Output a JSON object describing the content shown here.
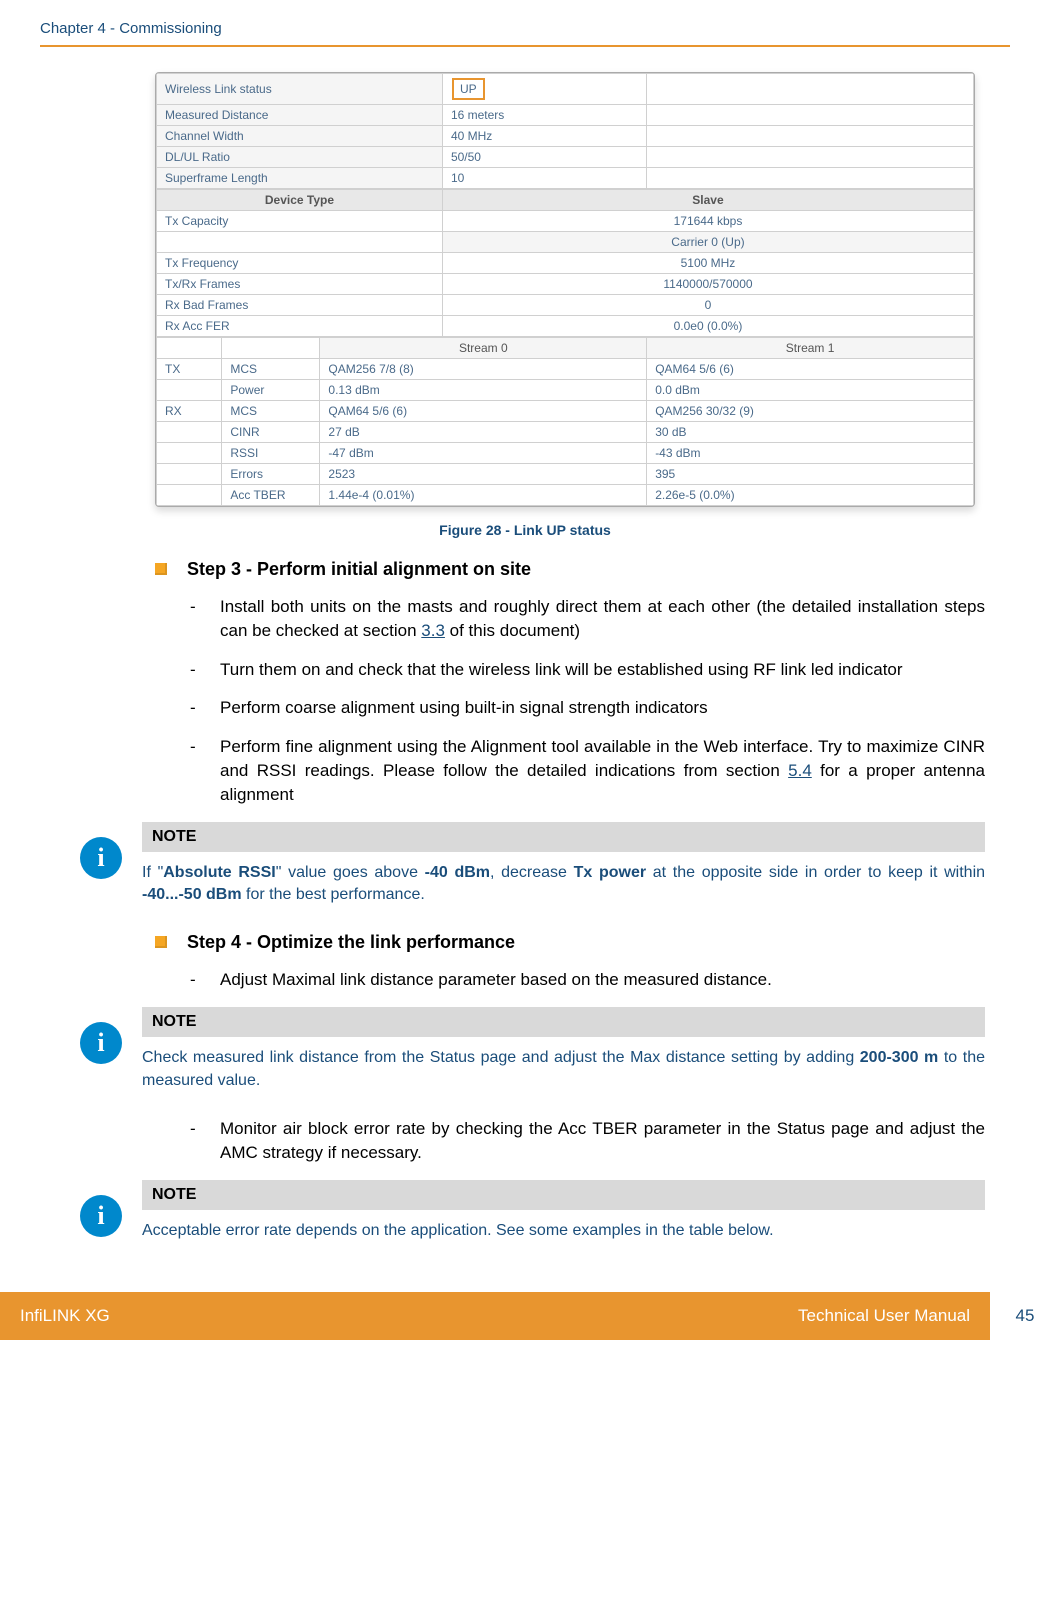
{
  "header": {
    "chapter": "Chapter 4 - Commissioning"
  },
  "screenshot": {
    "rows1": [
      {
        "label": "Wireless Link status",
        "value": "UP",
        "highlight": true
      },
      {
        "label": "Measured Distance",
        "value": "16 meters"
      },
      {
        "label": "Channel Width",
        "value": "40 MHz"
      },
      {
        "label": "DL/UL Ratio",
        "value": "50/50"
      },
      {
        "label": "Superframe Length",
        "value": "10"
      }
    ],
    "device_type_hdr": "Device Type",
    "slave_hdr": "Slave",
    "rows2": [
      {
        "label": "Tx Capacity",
        "value": "171644 kbps"
      },
      {
        "label": "",
        "value": "Carrier 0 (Up)"
      },
      {
        "label": "Tx Frequency",
        "value": "5100 MHz"
      },
      {
        "label": "Tx/Rx Frames",
        "value": "1140000/570000"
      },
      {
        "label": "Rx Bad Frames",
        "value": "0"
      },
      {
        "label": "Rx Acc FER",
        "value": "0.0e0 (0.0%)"
      }
    ],
    "stream0": "Stream 0",
    "stream1": "Stream 1",
    "stream_rows": [
      {
        "group": "TX",
        "label": "MCS",
        "s0": "QAM256 7/8 (8)",
        "s1": "QAM64 5/6 (6)"
      },
      {
        "group": "",
        "label": "Power",
        "s0": "0.13 dBm",
        "s1": "0.0 dBm"
      },
      {
        "group": "RX",
        "label": "MCS",
        "s0": "QAM64 5/6 (6)",
        "s1": "QAM256 30/32 (9)"
      },
      {
        "group": "",
        "label": "CINR",
        "s0": "27 dB",
        "s1": "30 dB"
      },
      {
        "group": "",
        "label": "RSSI",
        "s0": "-47 dBm",
        "s1": "-43 dBm"
      },
      {
        "group": "",
        "label": "Errors",
        "s0": "2523",
        "s1": "395"
      },
      {
        "group": "",
        "label": "Acc TBER",
        "s0": "1.44e-4 (0.01%)",
        "s1": "2.26e-5 (0.0%)"
      }
    ]
  },
  "figure_caption": "Figure 28 - Link UP status",
  "step3": {
    "title": "Step 3 - Perform initial alignment on site",
    "items": [
      {
        "pre": "Install both units on the masts and roughly direct them at each other (the detailed installation steps can be checked at section ",
        "link": "3.3",
        "post": " of this document)"
      },
      {
        "pre": "Turn them on and check that the wireless link will be established using RF link led indicator",
        "link": "",
        "post": ""
      },
      {
        "pre": "Perform coarse alignment using built-in signal strength indicators",
        "link": "",
        "post": ""
      },
      {
        "pre": "Perform fine alignment using the Alignment tool available in the Web interface. Try to  maximize CINR and RSSI readings. Please follow the detailed indications from section ",
        "link": "5.4",
        "post": " for a proper antenna alignment"
      }
    ]
  },
  "note1": {
    "header": "NOTE",
    "p1": "If \"",
    "b1": "Absolute RSSI",
    "p2": "\" value goes above ",
    "b2": "-40 dBm",
    "p3": ", decrease ",
    "b3": "Tx power",
    "p4": " at the opposite side in order to keep it within ",
    "b4": "-40...-50 dBm",
    "p5": " for the best performance."
  },
  "step4": {
    "title": "Step 4 - Optimize the link performance",
    "item1": "Adjust Maximal link distance parameter based on the measured distance."
  },
  "note2": {
    "header": "NOTE",
    "p1": "Check measured link distance from the Status page and adjust the Max distance setting by adding ",
    "b1": "200-300 m",
    "p2": " to the measured value."
  },
  "step4b": {
    "item": "Monitor air block error rate by checking the Acc TBER  parameter in the Status page and adjust the AMC strategy if necessary."
  },
  "note3": {
    "header": "NOTE",
    "text": "Acceptable error rate depends on the application. See some examples in the table below."
  },
  "footer": {
    "left": "InfiLINK XG",
    "right": "Technical User Manual",
    "page": "45"
  }
}
